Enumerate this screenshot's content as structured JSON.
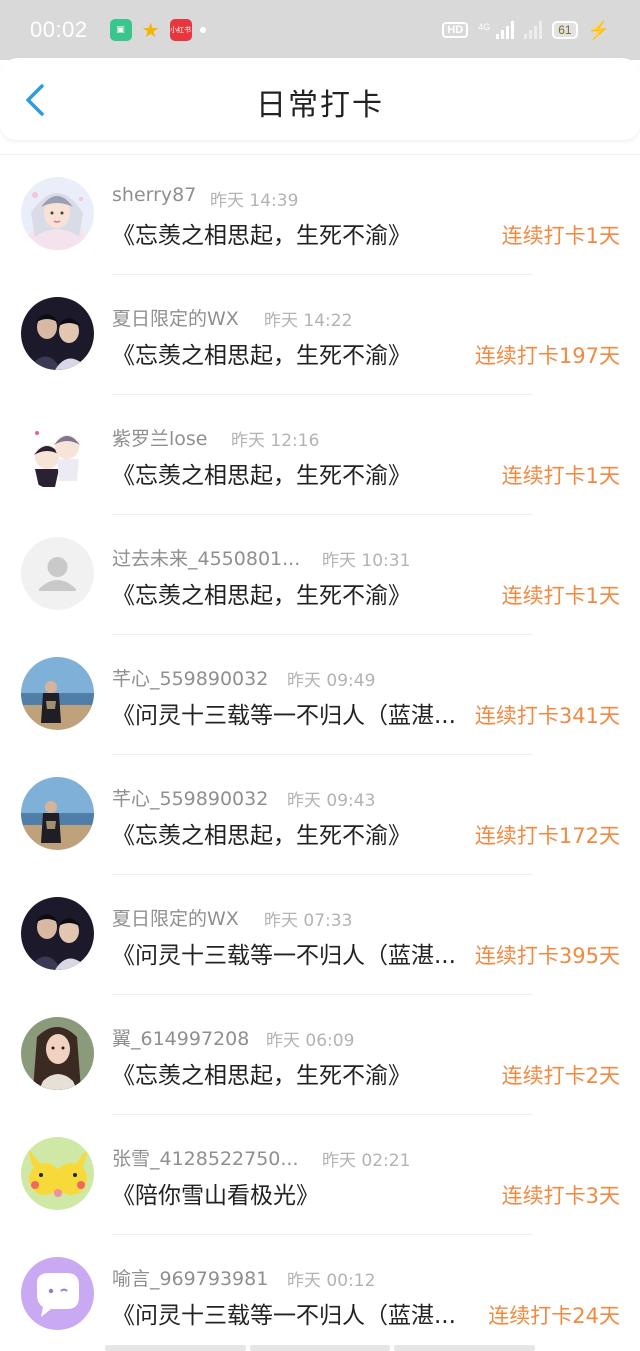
{
  "status_bar": {
    "time": "00:02",
    "app_badge_3": "小红书",
    "hd_label": "HD",
    "network_label": "4G",
    "battery": "61"
  },
  "header": {
    "title": "日常打卡"
  },
  "colors": {
    "accent_blue": "#2d9cdb",
    "streak_orange": "#f08a40",
    "status_bar_bg": "#d9d9d9"
  },
  "checkins": [
    {
      "username": "sherry87",
      "time": "昨天 14:39",
      "book": "《忘羡之相思起，生死不渝》",
      "streak": "连续打卡1天",
      "avatar": "avatar-anime-girl"
    },
    {
      "username": "夏日限定的WX",
      "time": "昨天 14:22",
      "book": "《忘羡之相思起，生死不渝》",
      "streak": "连续打卡197天",
      "avatar": "avatar-drama-duo"
    },
    {
      "username": "紫罗兰lose",
      "time": "昨天 12:16",
      "book": "《忘羡之相思起，生死不渝》",
      "streak": "连续打卡1天",
      "avatar": "avatar-chibi"
    },
    {
      "username": "过去未来_4550801...",
      "time": "昨天 10:31",
      "book": "《忘羡之相思起，生死不渝》",
      "streak": "连续打卡1天",
      "avatar": "avatar-default"
    },
    {
      "username": "芊心_559890032",
      "time": "昨天 09:49",
      "book": "《问灵十三载等一不归人（蓝湛...",
      "streak": "连续打卡341天",
      "avatar": "avatar-photo-seaside"
    },
    {
      "username": "芊心_559890032",
      "time": "昨天 09:43",
      "book": "《忘羡之相思起，生死不渝》",
      "streak": "连续打卡172天",
      "avatar": "avatar-photo-seaside"
    },
    {
      "username": "夏日限定的WX",
      "time": "昨天 07:33",
      "book": "《问灵十三载等一不归人（蓝湛...",
      "streak": "连续打卡395天",
      "avatar": "avatar-drama-duo"
    },
    {
      "username": "翼_614997208",
      "time": "昨天 06:09",
      "book": "《忘羡之相思起，生死不渝》",
      "streak": "连续打卡2天",
      "avatar": "avatar-woman-portrait"
    },
    {
      "username": "张雪_4128522750...",
      "time": "昨天 02:21",
      "book": "《陪你雪山看极光》",
      "streak": "连续打卡3天",
      "avatar": "avatar-pikachu"
    },
    {
      "username": "喻言_969793981",
      "time": "昨天 00:12",
      "book": "《问灵十三载等一不归人（蓝湛...",
      "streak": "连续打卡24天",
      "avatar": "avatar-chat-bubble"
    }
  ]
}
